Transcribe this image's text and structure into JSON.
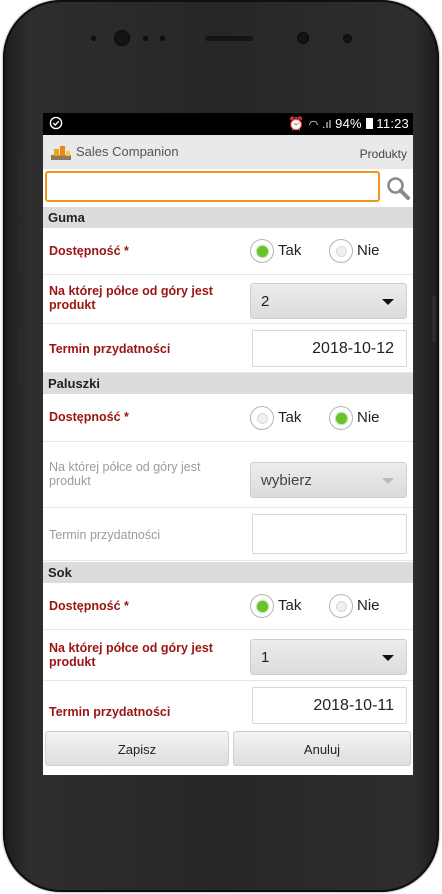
{
  "status_bar": {
    "time": "11:23",
    "battery": "94%"
  },
  "app": {
    "title": "Sales Companion",
    "nav_label": "Produkty"
  },
  "search": {
    "value": "",
    "placeholder": ""
  },
  "labels": {
    "availability": "Dostępność *",
    "shelf": "Na której półce od góry jest produkt",
    "expiry": "Termin przydatności",
    "yes": "Tak",
    "no": "Nie"
  },
  "products": [
    {
      "name": "Guma",
      "availability": "Tak",
      "shelf": "2",
      "expiry": "2018-10-12"
    },
    {
      "name": "Paluszki",
      "availability": "Nie",
      "shelf": "wybierz",
      "expiry": ""
    },
    {
      "name": "Sok",
      "availability": "Tak",
      "shelf": "1",
      "expiry": "2018-10-11"
    }
  ],
  "buttons": {
    "save": "Zapisz",
    "cancel": "Anuluj"
  },
  "colors": {
    "accent_orange": "#f0961e",
    "required_label": "#9b1414",
    "radio_selected": "#66c42a",
    "section_header": "#dcdcdc",
    "app_bar": "#e9e9e9"
  }
}
